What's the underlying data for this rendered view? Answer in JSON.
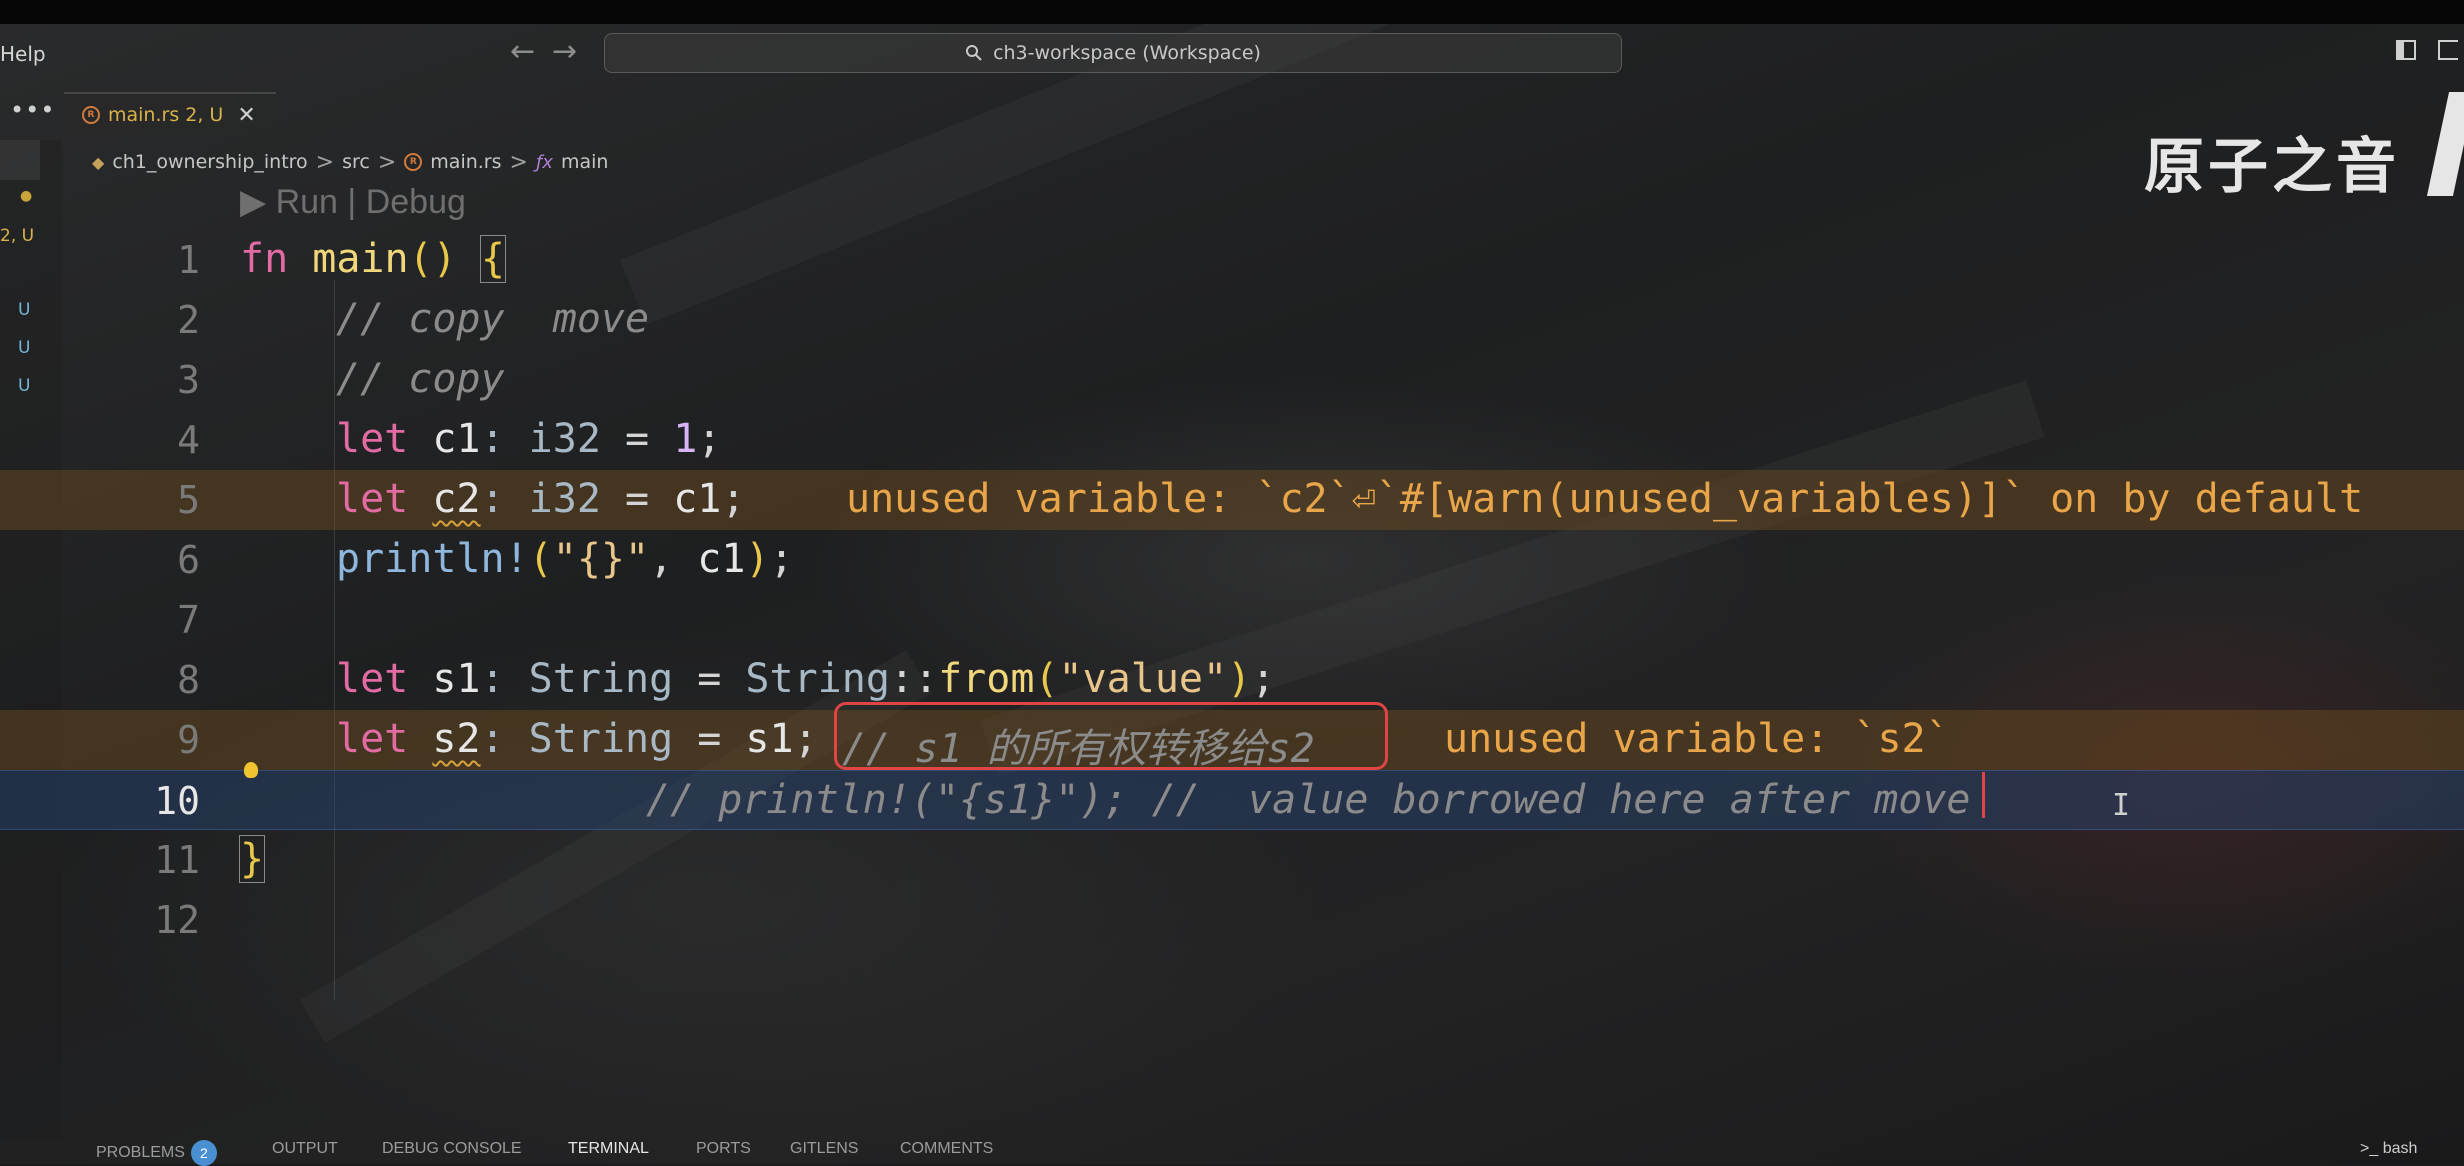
{
  "titlebar": {
    "menu_help": "Help",
    "back_arrow": "←",
    "forward_arrow": "→",
    "search_text": "ch3-workspace (Workspace)"
  },
  "sidebar": {
    "more": "•••",
    "markers": [
      "●",
      "2, U",
      "U",
      "U",
      "U"
    ]
  },
  "tab": {
    "label": "main.rs 2, U",
    "close": "✕"
  },
  "breadcrumb": {
    "items": [
      "ch1_ownership_intro",
      "src",
      "main.rs",
      "main"
    ],
    "sep": ">"
  },
  "watermark": "原子之音",
  "editor": {
    "codelens": "▶ Run | Debug",
    "lines": [
      {
        "n": "1"
      },
      {
        "n": "2",
        "comment": "// copy  move"
      },
      {
        "n": "3",
        "comment": "// copy"
      },
      {
        "n": "4"
      },
      {
        "n": "5",
        "warning": "unused variable: `c2`⏎`#[warn(unused_variables)]` on by default"
      },
      {
        "n": "6"
      },
      {
        "n": "7"
      },
      {
        "n": "8"
      },
      {
        "n": "9",
        "comment": "// s1 的所有权转移给s2",
        "warning": "unused variable: `s2`"
      },
      {
        "n": "10",
        "comment": "// println!(\"{s1}\"); //  value borrowed here after move"
      },
      {
        "n": "11"
      },
      {
        "n": "12"
      }
    ]
  },
  "panel": {
    "tabs": [
      "PROBLEMS",
      "OUTPUT",
      "DEBUG CONSOLE",
      "TERMINAL",
      "PORTS",
      "GITLENS",
      "COMMENTS"
    ],
    "problems_count": "2",
    "terminal_label": "bash"
  }
}
